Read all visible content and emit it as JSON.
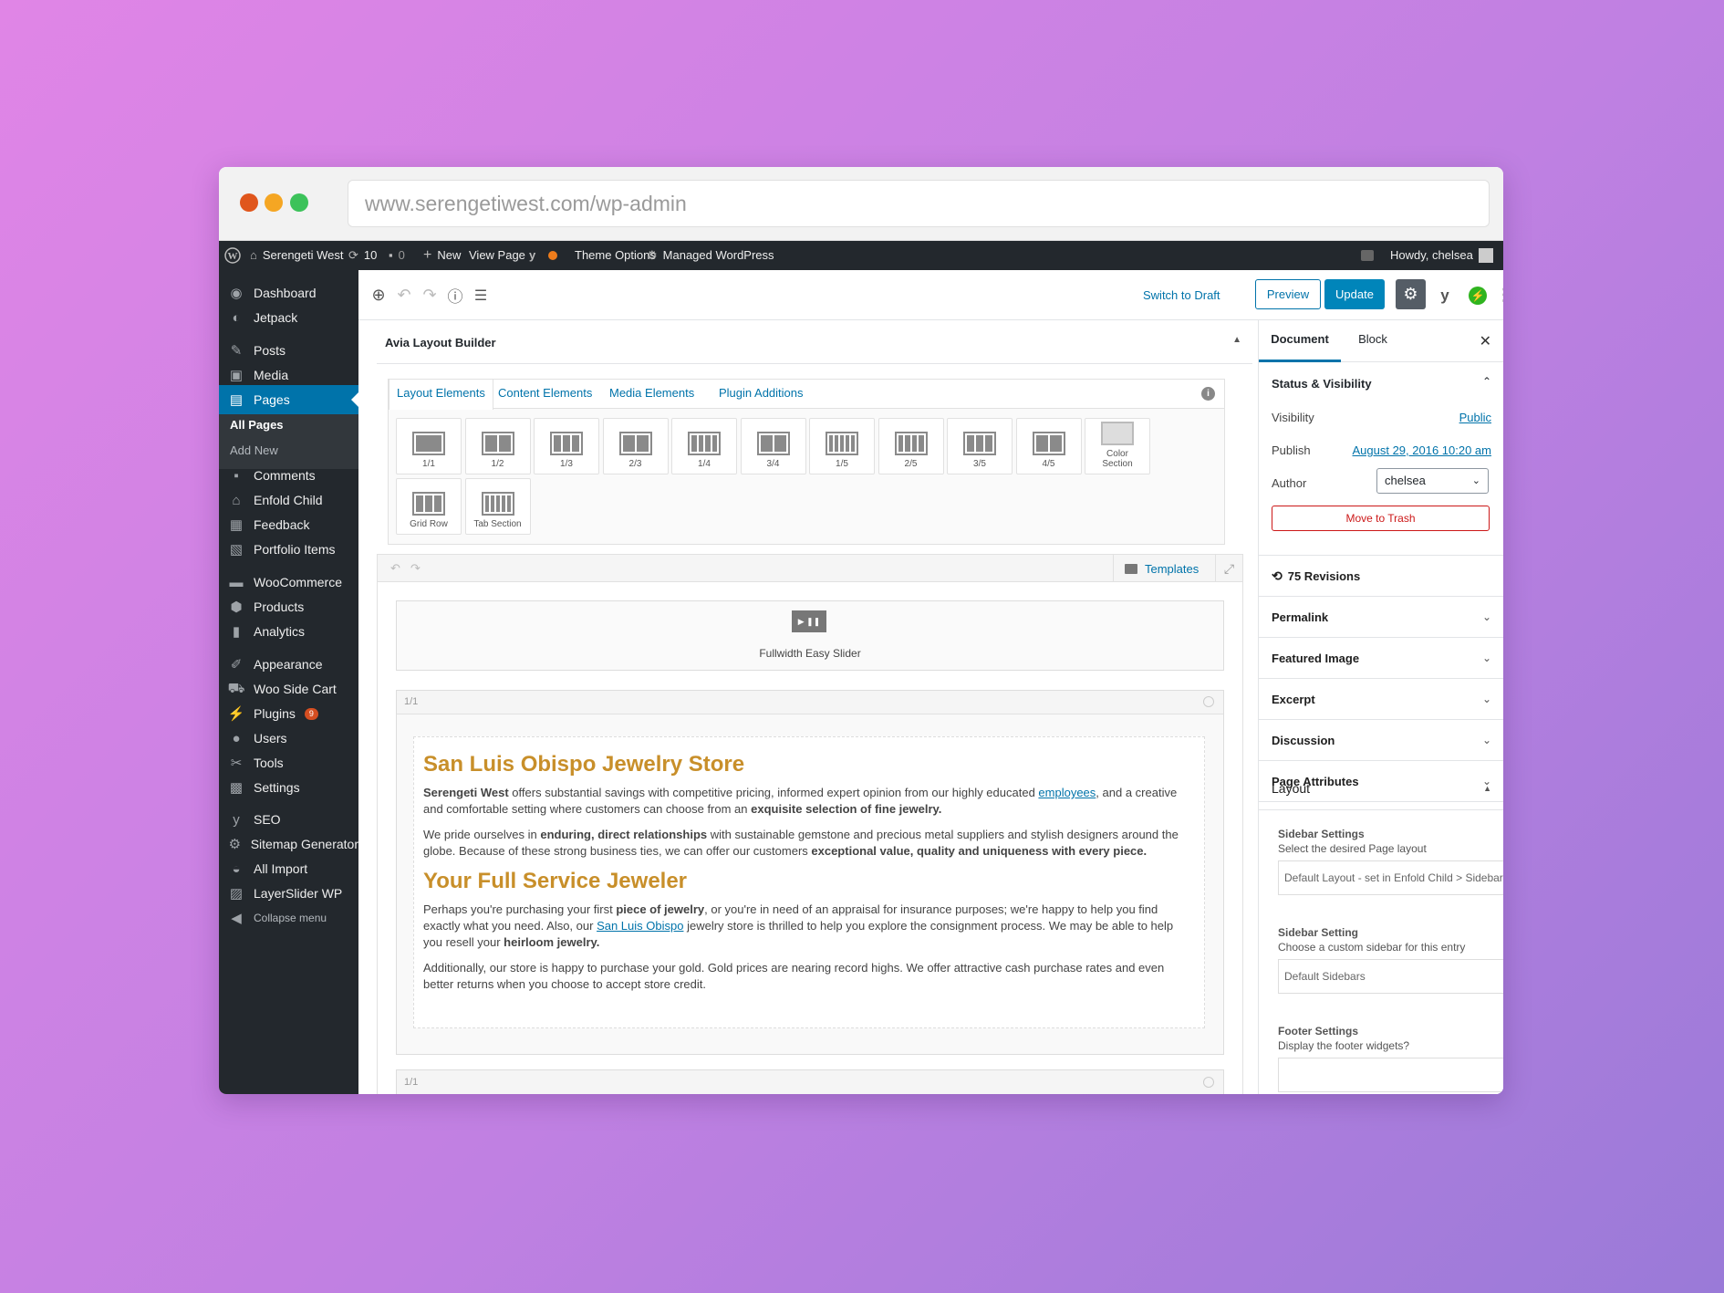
{
  "browser": {
    "url": "www.serengetiwest.com/wp-admin"
  },
  "admin_bar": {
    "site_name": "Serengeti West",
    "updates_count": "10",
    "comments_count": "0",
    "new_label": "New",
    "view_page_label": "View Page",
    "theme_options_label": "Theme Options",
    "managed_wp_label": "Managed WordPress",
    "howdy_label": "Howdy, chelsea"
  },
  "sidebar": {
    "items": [
      {
        "label": "Dashboard",
        "icon": "dashboard-icon"
      },
      {
        "label": "Jetpack",
        "icon": "jetpack-icon"
      },
      {
        "label": "Posts",
        "icon": "pin-icon"
      },
      {
        "label": "Media",
        "icon": "media-icon"
      },
      {
        "label": "Pages",
        "icon": "pages-icon"
      },
      {
        "label": "Comments",
        "icon": "comment-icon"
      },
      {
        "label": "Enfold Child",
        "icon": "home-icon"
      },
      {
        "label": "Feedback",
        "icon": "feedback-icon"
      },
      {
        "label": "Portfolio Items",
        "icon": "portfolio-icon"
      },
      {
        "label": "WooCommerce",
        "icon": "woo-icon"
      },
      {
        "label": "Products",
        "icon": "box-icon"
      },
      {
        "label": "Analytics",
        "icon": "bar-chart-icon"
      },
      {
        "label": "Appearance",
        "icon": "brush-icon"
      },
      {
        "label": "Woo Side Cart",
        "icon": "cart-icon"
      },
      {
        "label": "Plugins",
        "icon": "plug-icon",
        "badge": "9"
      },
      {
        "label": "Users",
        "icon": "user-icon"
      },
      {
        "label": "Tools",
        "icon": "wrench-icon"
      },
      {
        "label": "Settings",
        "icon": "settings-icon"
      },
      {
        "label": "SEO",
        "icon": "yoast-icon"
      },
      {
        "label": "Sitemap Generator",
        "icon": "gear-icon"
      },
      {
        "label": "All Import",
        "icon": "import-icon"
      },
      {
        "label": "LayerSlider WP",
        "icon": "layers-icon"
      },
      {
        "label": "Collapse menu",
        "icon": "collapse-icon"
      }
    ],
    "submenu": {
      "all_pages": "All Pages",
      "add_new": "Add New"
    }
  },
  "toolbar": {
    "switch_to_draft": "Switch to Draft",
    "preview": "Preview",
    "update": "Update"
  },
  "builder": {
    "title": "Avia Layout Builder",
    "tabs": [
      "Layout Elements",
      "Content Elements",
      "Media Elements",
      "Plugin Additions"
    ],
    "elements": [
      "1/1",
      "1/2",
      "1/3",
      "2/3",
      "1/4",
      "3/4",
      "1/5",
      "2/5",
      "3/5",
      "4/5",
      "Color Section",
      "Grid Row",
      "Tab Section"
    ],
    "templates_label": "Templates",
    "slider_label": "Fullwidth Easy Slider",
    "row_label": "1/1",
    "row2_label": "1/1"
  },
  "content": {
    "h1": "San Luis Obispo Jewelry Store",
    "p1_a": "Serengeti West",
    "p1_b": " offers substantial savings with competitive pricing, informed expert opinion from our highly educated ",
    "p1_link": "employees",
    "p1_c": ", and a creative and comfortable setting where customers can choose from an ",
    "p1_d": "exquisite selection of fine jewelry.",
    "p2_a": "We pride ourselves in ",
    "p2_b": "enduring, direct relationships",
    "p2_c": " with sustainable gemstone and precious metal suppliers and stylish designers around the globe. Because of these strong business ties, we can offer our customers ",
    "p2_d": "exceptional value, quality and uniqueness with every piece.",
    "h2": "Your Full Service Jeweler",
    "p3_a": "Perhaps you're purchasing your first ",
    "p3_b": "piece of jewelry",
    "p3_c": ", or you're in need of an appraisal for insurance purposes; we're happy to help you find exactly what you need. Also, our ",
    "p3_link": "San Luis Obispo",
    "p3_d": " jewelry store is thrilled to help you explore the consignment process. We may be able to help you resell your ",
    "p3_e": "heirloom jewelry.",
    "p4": "Additionally, our store is happy to purchase your gold. Gold prices are nearing record highs. We offer attractive cash purchase rates and even better returns when you choose to accept store credit."
  },
  "panel": {
    "tab_document": "Document",
    "tab_block": "Block",
    "status_title": "Status & Visibility",
    "visibility_label": "Visibility",
    "visibility_value": "Public",
    "publish_label": "Publish",
    "publish_value": "August 29, 2016 10:20 am",
    "author_label": "Author",
    "author_value": "chelsea",
    "trash_label": "Move to Trash",
    "revisions": "75 Revisions",
    "sections": [
      "Permalink",
      "Featured Image",
      "Excerpt",
      "Discussion",
      "Page Attributes"
    ],
    "layout_title": "Layout",
    "sidebar_settings_title": "Sidebar Settings",
    "sidebar_settings_desc": "Select the desired Page layout",
    "sidebar_settings_value": "Default Layout - set in Enfold Child > Sidebar",
    "sidebar_setting_title": "Sidebar Setting",
    "sidebar_setting_desc": "Choose a custom sidebar for this entry",
    "sidebar_setting_value": "Default Sidebars",
    "footer_title": "Footer Settings",
    "footer_desc": "Display the footer widgets?"
  },
  "colors": {
    "accent": "#0073aa",
    "admin_dark": "#23282d",
    "heading_gold": "#c88f2a",
    "trash_red": "#cc1818"
  }
}
